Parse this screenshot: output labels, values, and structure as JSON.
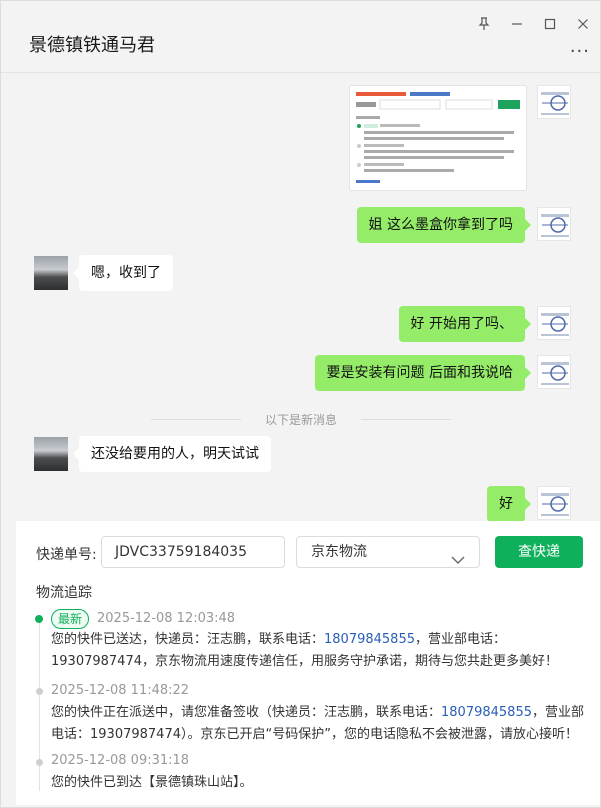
{
  "window": {
    "title": "景德镇铁通马君",
    "controls": [
      "pin-icon",
      "minimize-icon",
      "maximize-icon",
      "close-icon"
    ],
    "more_label": "···"
  },
  "chat": {
    "messages": [
      {
        "from": "me",
        "type": "image"
      },
      {
        "from": "me",
        "text": "姐 这么墨盒你拿到了吗"
      },
      {
        "from": "other",
        "text": "嗯，收到了"
      },
      {
        "from": "me",
        "text": "好  开始用了吗、"
      },
      {
        "from": "me",
        "text": "要是安装有问题  后面和我说哈"
      },
      {
        "from": "other",
        "text": "还没给要用的人，明天试试"
      },
      {
        "from": "me",
        "text": "好"
      }
    ],
    "divider": "以下是新消息"
  },
  "logistics": {
    "tracking_label": "快递单号:",
    "tracking_number": "JDVC33759184035",
    "carrier": "京东物流",
    "query_button": "查快递",
    "section_title": "物流追踪",
    "latest_badge": "最新",
    "events": [
      {
        "time": "2025-12-08 12:03:48",
        "text_a": "您的快件已送达，快递员：汪志鹏，联系电话：",
        "phone_a": "18079845855",
        "text_b": "，营业部电话：",
        "text_c": "19307987474，京东物流用速度传递信任，用服务守护承诺，期待与您共赴更多美好！"
      },
      {
        "time": "2025-12-08 11:48:22",
        "text_a": "您的快件正在派送中，请您准备签收（快递员：汪志鹏，联系电话：",
        "phone_a": "18079845855",
        "text_b": "，营业部",
        "text_c": "电话：19307987474）。京东已开启“号码保护”，您的电话隐私不会被泄露，请放心接听！"
      },
      {
        "time": "2025-12-08 09:31:18",
        "text_a": "您的快件已到达【景德镇珠山站】。"
      }
    ]
  },
  "colors": {
    "accent_green": "#0fb05b",
    "bubble_me": "#95ec69",
    "phone_link": "#2a5fb8"
  }
}
